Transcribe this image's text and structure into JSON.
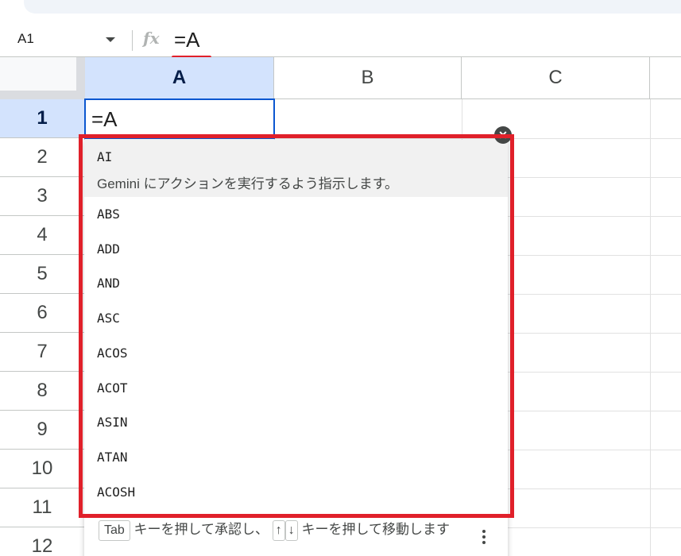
{
  "formula_bar": {
    "name_box": "A1",
    "fx_label": "fx",
    "formula": "=A"
  },
  "columns": [
    {
      "label": "A",
      "selected": true
    },
    {
      "label": "B",
      "selected": false
    },
    {
      "label": "C",
      "selected": false
    }
  ],
  "rows": [
    {
      "label": "1",
      "selected": true
    },
    {
      "label": "2"
    },
    {
      "label": "3"
    },
    {
      "label": "4"
    },
    {
      "label": "5"
    },
    {
      "label": "6"
    },
    {
      "label": "7"
    },
    {
      "label": "8"
    },
    {
      "label": "9"
    },
    {
      "label": "10"
    },
    {
      "label": "11"
    },
    {
      "label": "12"
    }
  ],
  "cell_a1": "=A",
  "autocomplete": {
    "items": [
      {
        "name": "AI",
        "description": "Gemini にアクションを実行するよう指示します。"
      },
      {
        "name": "ABS"
      },
      {
        "name": "ADD"
      },
      {
        "name": "AND"
      },
      {
        "name": "ASC"
      },
      {
        "name": "ACOS"
      },
      {
        "name": "ACOT"
      },
      {
        "name": "ASIN"
      },
      {
        "name": "ATAN"
      },
      {
        "name": "ACOSH"
      }
    ],
    "footer": {
      "tab_key": "Tab",
      "text1": "キーを押して承認し、",
      "up_key": "↑",
      "down_key": "↓",
      "text2": "キーを押して移動します"
    },
    "close_icon": "close-icon"
  },
  "colors": {
    "accent": "#0b57d0",
    "selected_header": "#d3e3fd",
    "annotation_red": "#e0202a"
  }
}
